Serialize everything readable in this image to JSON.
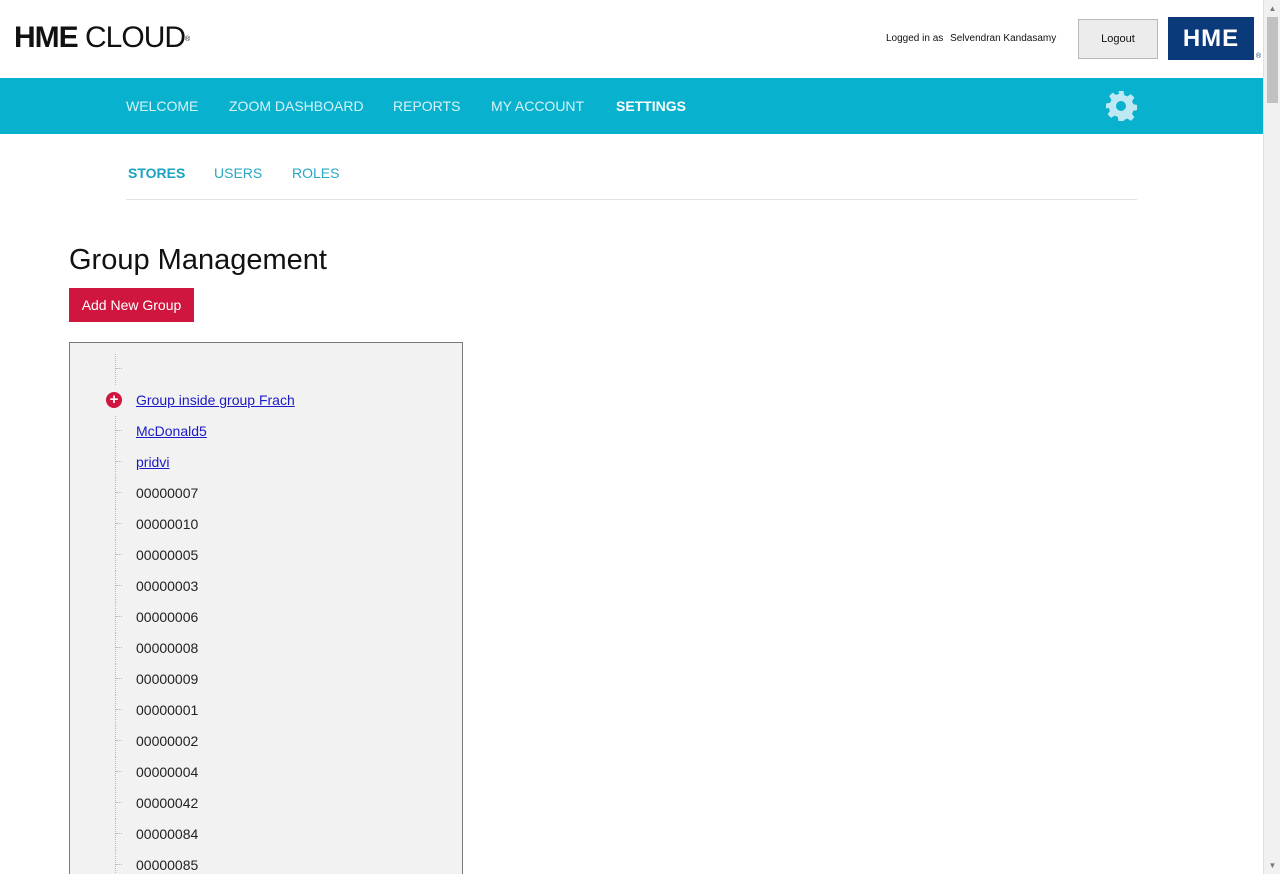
{
  "header": {
    "logo_bold": "HME",
    "logo_light": "CLOUD",
    "logo_mark": "®",
    "logged_in_label": "Logged in as",
    "user_name": "Selvendran Kandasamy",
    "logout_label": "Logout",
    "brand_badge": "HME",
    "brand_badge_mark": "®"
  },
  "nav": {
    "items": [
      {
        "label": "WELCOME",
        "active": false
      },
      {
        "label": "ZOOM DASHBOARD",
        "active": false
      },
      {
        "label": "REPORTS",
        "active": false
      },
      {
        "label": "MY ACCOUNT",
        "active": false
      },
      {
        "label": "SETTINGS",
        "active": true
      }
    ],
    "settings_icon": "gear-icon",
    "accent_color": "#08b1cd"
  },
  "subnav": {
    "items": [
      {
        "label": "STORES",
        "active": true
      },
      {
        "label": "USERS",
        "active": false
      },
      {
        "label": "ROLES",
        "active": false
      }
    ]
  },
  "main": {
    "title": "Group Management",
    "add_button_label": "Add New Group",
    "add_button_color": "#d0153e",
    "tree": {
      "expand_icon": "plus-circle-icon",
      "items": [
        {
          "label": "",
          "type": "blank"
        },
        {
          "label": "Group inside group Frach",
          "type": "group"
        },
        {
          "label": "McDonald5",
          "type": "link"
        },
        {
          "label": "pridvi",
          "type": "link"
        },
        {
          "label": "00000007",
          "type": "store"
        },
        {
          "label": "00000010",
          "type": "store"
        },
        {
          "label": "00000005",
          "type": "store"
        },
        {
          "label": "00000003",
          "type": "store"
        },
        {
          "label": "00000006",
          "type": "store"
        },
        {
          "label": "00000008",
          "type": "store"
        },
        {
          "label": "00000009",
          "type": "store"
        },
        {
          "label": "00000001",
          "type": "store"
        },
        {
          "label": "00000002",
          "type": "store"
        },
        {
          "label": "00000004",
          "type": "store"
        },
        {
          "label": "00000042",
          "type": "store"
        },
        {
          "label": "00000084",
          "type": "store"
        },
        {
          "label": "00000085",
          "type": "store"
        }
      ]
    }
  }
}
